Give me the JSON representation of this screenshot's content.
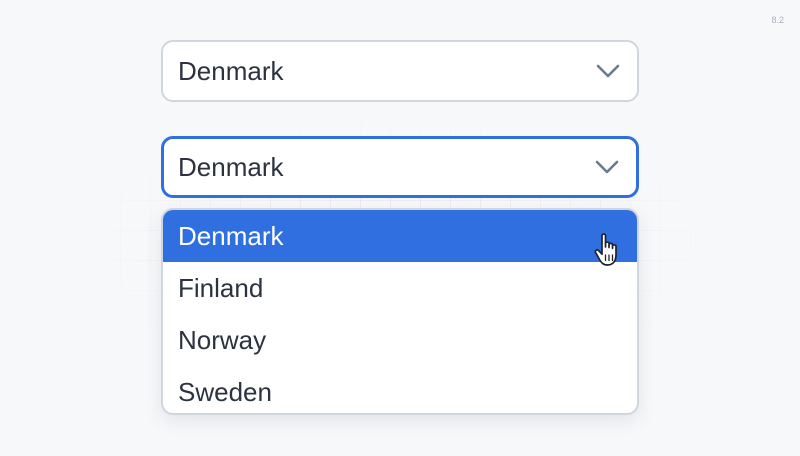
{
  "version_label": "8.2",
  "select_closed": {
    "value": "Denmark",
    "icon": "chevron-down-icon"
  },
  "select_open": {
    "value": "Denmark",
    "icon": "chevron-down-icon",
    "options": [
      "Denmark",
      "Finland",
      "Norway",
      "Sweden"
    ],
    "selected_index": 0
  },
  "colors": {
    "accent": "#2f6fe0",
    "border": "#cfd6e0",
    "text": "#2b3341",
    "chevron": "#6b7a90"
  }
}
